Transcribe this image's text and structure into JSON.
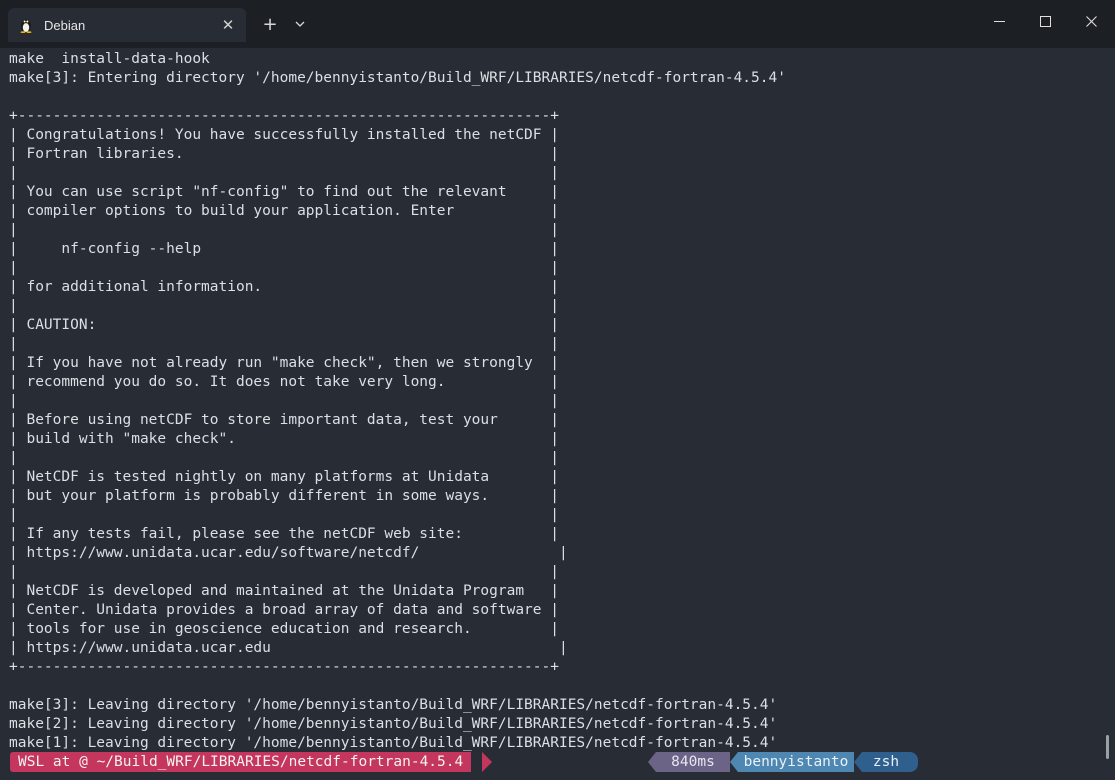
{
  "window": {
    "tab_title": "Debian",
    "tab_icon": "tux-penguin-icon",
    "new_tab_glyph": "+",
    "dropdown_glyph": "⌄",
    "close_glyph": "✕"
  },
  "terminal": {
    "lines": [
      "make  install-data-hook",
      "make[3]: Entering directory '/home/bennyistanto/Build_WRF/LIBRARIES/netcdf-fortran-4.5.4'",
      "",
      "+-------------------------------------------------------------+",
      "| Congratulations! You have successfully installed the netCDF |",
      "| Fortran libraries.                                          |",
      "|                                                             |",
      "| You can use script \"nf-config\" to find out the relevant     |",
      "| compiler options to build your application. Enter           |",
      "|                                                             |",
      "|     nf-config --help                                        |",
      "|                                                             |",
      "| for additional information.                                 |",
      "|                                                             |",
      "| CAUTION:                                                    |",
      "|                                                             |",
      "| If you have not already run \"make check\", then we strongly  |",
      "| recommend you do so. It does not take very long.            |",
      "|                                                             |",
      "| Before using netCDF to store important data, test your      |",
      "| build with \"make check\".                                    |",
      "|                                                             |",
      "| NetCDF is tested nightly on many platforms at Unidata       |",
      "| but your platform is probably different in some ways.       |",
      "|                                                             |",
      "| If any tests fail, please see the netCDF web site:          |",
      "| https://www.unidata.ucar.edu/software/netcdf/                |",
      "|                                                             |",
      "| NetCDF is developed and maintained at the Unidata Program   |",
      "| Center. Unidata provides a broad array of data and software |",
      "| tools for use in geoscience education and research.         |",
      "| https://www.unidata.ucar.edu                                 |",
      "+-------------------------------------------------------------+",
      "",
      "make[3]: Leaving directory '/home/bennyistanto/Build_WRF/LIBRARIES/netcdf-fortran-4.5.4'",
      "make[2]: Leaving directory '/home/bennyistanto/Build_WRF/LIBRARIES/netcdf-fortran-4.5.4'",
      "make[1]: Leaving directory '/home/bennyistanto/Build_WRF/LIBRARIES/netcdf-fortran-4.5.4'"
    ]
  },
  "prompt": {
    "left": "WSL at @ ~/Build_WRF/LIBRARIES/netcdf-fortran-4.5.4",
    "duration": "840ms",
    "user": "bennyistanto",
    "shell": "zsh"
  },
  "colors": {
    "background": "#282c34",
    "titlebar": "#1c1f24",
    "text": "#dcdfe4",
    "prompt_left": "#c5365e",
    "prompt_time": "#6c6487",
    "prompt_user": "#4e88b2",
    "prompt_shell": "#2f5f8c"
  }
}
